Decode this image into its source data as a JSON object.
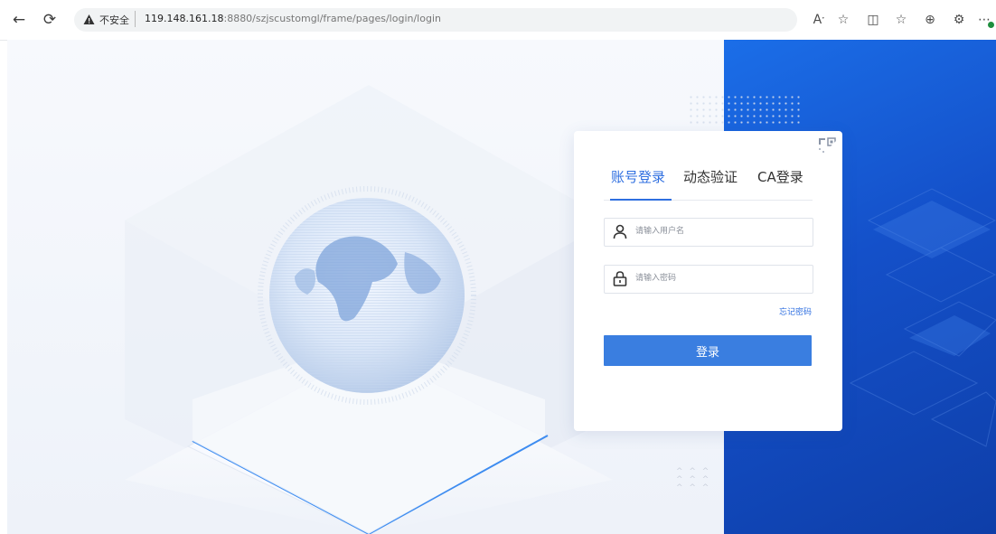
{
  "browser": {
    "security_label": "不安全",
    "url_host": "119.148.161.18",
    "url_path": ":8880/szjscustomgl/frame/pages/login/login",
    "icons": [
      "back-icon",
      "refresh-icon",
      "warning-icon",
      "read-aloud-icon",
      "favorite-icon",
      "split-screen-icon",
      "favorites-list-icon",
      "collections-icon",
      "extensions-icon",
      "more-icon"
    ]
  },
  "login": {
    "tabs": [
      {
        "label": "账号登录",
        "active": true
      },
      {
        "label": "动态验证",
        "active": false
      },
      {
        "label": "CA登录",
        "active": false
      }
    ],
    "username_placeholder": "请输入用户名",
    "password_placeholder": "请输入密码",
    "forgot_password": "忘记密码",
    "submit_label": "登录"
  },
  "colors": {
    "accent": "#2f6fe0",
    "button": "#3a7ee0",
    "panel_blue": "#1450c9"
  }
}
